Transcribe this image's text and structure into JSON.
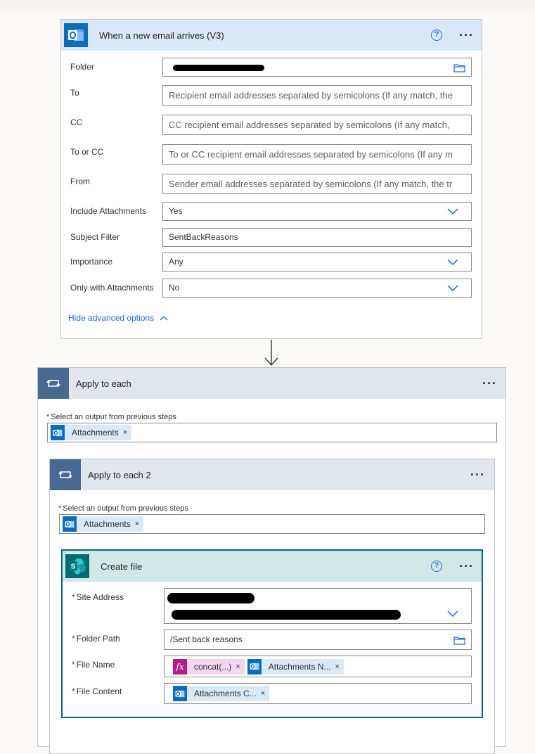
{
  "trigger": {
    "title": "When a new email arrives (V3)",
    "icon": "outlook-icon",
    "fields": {
      "folder": {
        "label": "Folder"
      },
      "to": {
        "label": "To",
        "placeholder": "Recipient email addresses separated by semicolons (If any match, the"
      },
      "cc": {
        "label": "CC",
        "placeholder": "CC recipient email addresses separated by semicolons (If any match,"
      },
      "to_or_cc": {
        "label": "To or CC",
        "placeholder": "To or CC recipient email addresses separated by semicolons (If any m"
      },
      "from": {
        "label": "From",
        "placeholder": "Sender email addresses separated by semicolons (If any match, the tr"
      },
      "include_attachments": {
        "label": "Include Attachments",
        "value": "Yes"
      },
      "subject_filter": {
        "label": "Subject Filter",
        "value": "SentBackReasons"
      },
      "importance": {
        "label": "Importance",
        "value": "Any"
      },
      "only_with_attachments": {
        "label": "Only with Attachments",
        "value": "No"
      }
    },
    "advanced_link": "Hide advanced options"
  },
  "apply_each": {
    "title": "Apply to each",
    "select_label": "Select an output from previous steps",
    "token": "Attachments",
    "token_close": "×"
  },
  "apply_each_2": {
    "title": "Apply to each 2",
    "select_label": "Select an output from previous steps",
    "token": "Attachments",
    "token_close": "×"
  },
  "create_file": {
    "title": "Create file",
    "fields": {
      "site_address": {
        "label": "Site Address"
      },
      "folder_path": {
        "label": "Folder Path",
        "value": "/Sent back reasons"
      },
      "file_name": {
        "label": "File Name",
        "tokens": [
          "concat(...)",
          "Attachments N..."
        ]
      },
      "file_content": {
        "label": "File Content",
        "tokens": [
          "Attachments C..."
        ]
      }
    },
    "token_close": "×",
    "fx_glyph": "fx"
  },
  "ellipsis": "···",
  "help_glyph": "?",
  "required_mark": "*",
  "colors": {
    "outlook": "#0f6cbd",
    "sharepoint": "#036c70",
    "loop": "#486991",
    "link": "#2266e3",
    "fx": "#ad1f87"
  }
}
